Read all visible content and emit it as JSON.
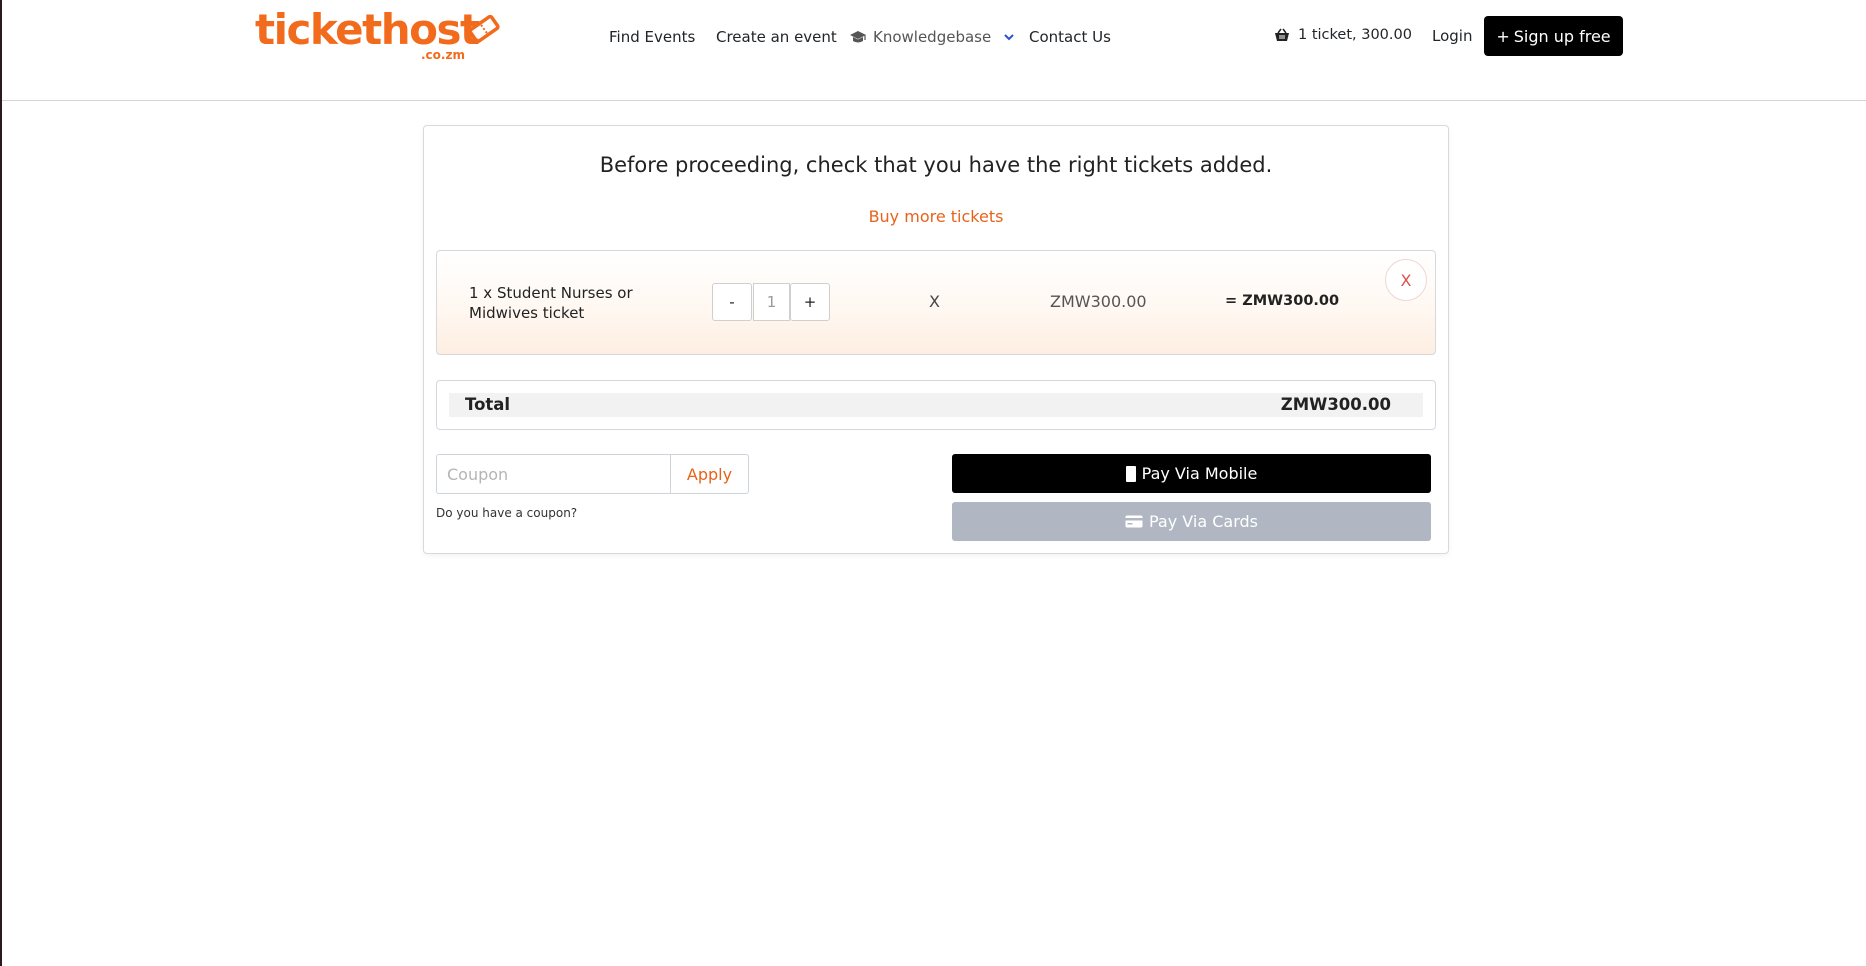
{
  "brand": {
    "name": "tickethost",
    "domain_suffix": ".co.zm",
    "color": "#f26b1d"
  },
  "nav": {
    "items": [
      {
        "label": "Find Events"
      },
      {
        "label": "Create an event"
      },
      {
        "label": "Knowledgebase",
        "icon": "graduation-cap-icon",
        "has_dropdown": true
      },
      {
        "label": "Contact Us"
      }
    ]
  },
  "header": {
    "cart_text": "1 ticket, 300.00",
    "cart_icon": "basket-icon",
    "login_label": "Login",
    "signup_label": "Sign up free"
  },
  "checkout": {
    "headline": "Before proceeding, check that you have the right tickets added.",
    "buy_more_label": "Buy more tickets",
    "ticket": {
      "name": "1 x Student Nurses or Midwives ticket",
      "minus_label": "-",
      "quantity": "1",
      "plus_label": "+",
      "times_label": "X",
      "unit_price": "ZMW300.00",
      "line_total": "= ZMW300.00",
      "remove_label": "X"
    },
    "total_label": "Total",
    "total_value": "ZMW300.00",
    "coupon": {
      "placeholder": "Coupon",
      "value": "",
      "apply_label": "Apply",
      "help_text": "Do you have a coupon?"
    },
    "pay_mobile_label": "Pay Via Mobile",
    "pay_cards_label": "Pay Via Cards"
  },
  "colors": {
    "accent": "#e8631a",
    "primary_button": "#000000",
    "disabled_button": "#b0b7c2",
    "remove": "#d9534f"
  }
}
